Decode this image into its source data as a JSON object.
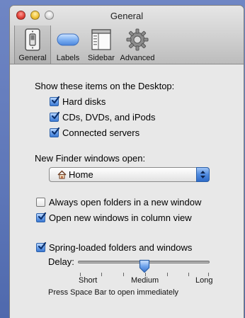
{
  "window": {
    "title": "General"
  },
  "toolbar": {
    "tabs": [
      {
        "label": "General",
        "icon": "light-switch-icon",
        "selected": true
      },
      {
        "label": "Labels",
        "icon": "label-pill-icon",
        "selected": false
      },
      {
        "label": "Sidebar",
        "icon": "sidebar-icon",
        "selected": false
      },
      {
        "label": "Advanced",
        "icon": "gear-icon",
        "selected": false
      }
    ]
  },
  "desktop": {
    "heading": "Show these items on the Desktop:",
    "items": [
      {
        "label": "Hard disks",
        "checked": true
      },
      {
        "label": "CDs, DVDs, and iPods",
        "checked": true
      },
      {
        "label": "Connected servers",
        "checked": true
      }
    ]
  },
  "new_window": {
    "heading": "New Finder windows open:",
    "selected": "Home",
    "icon": "home-icon"
  },
  "options": [
    {
      "label": "Always open folders in a new window",
      "checked": false
    },
    {
      "label": "Open new windows in column view",
      "checked": true
    }
  ],
  "spring": {
    "label": "Spring-loaded folders and windows",
    "checked": true,
    "delay_label": "Delay:",
    "short": "Short",
    "medium": "Medium",
    "long": "Long",
    "value": 0.5,
    "hint": "Press Space Bar to open immediately"
  },
  "colors": {
    "accent": "#3d79d2",
    "desktop_bg": "#5d76b8"
  }
}
